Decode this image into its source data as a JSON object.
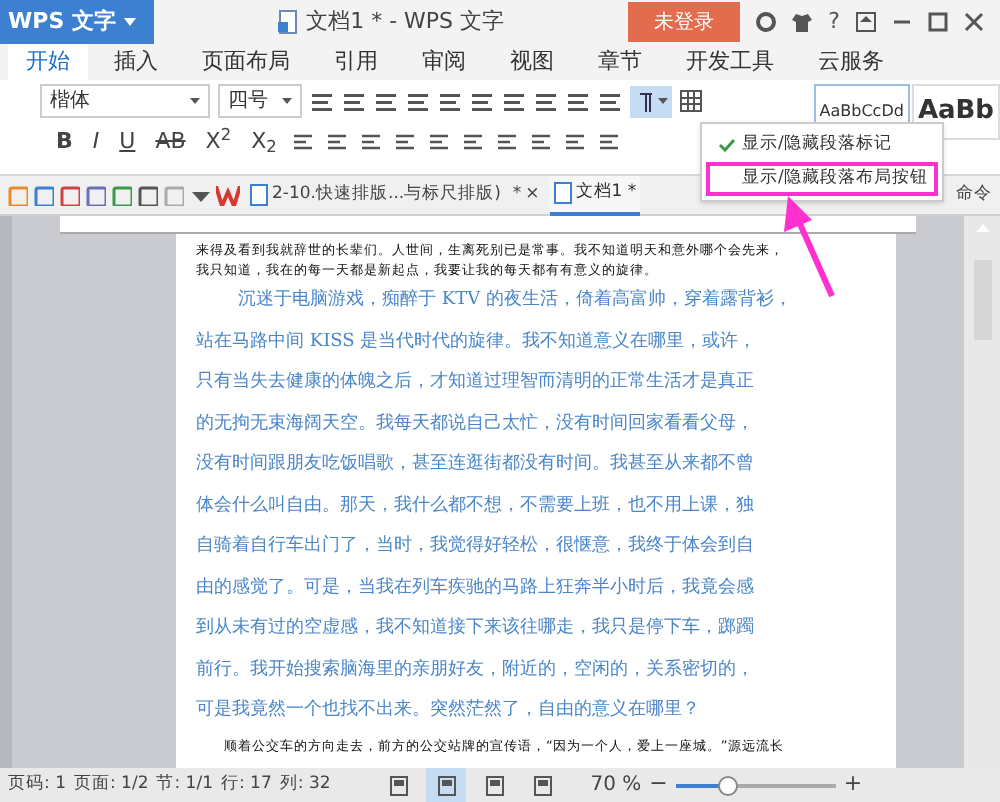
{
  "app_button": {
    "label": "WPS 文字"
  },
  "window": {
    "title": "文档1 * - WPS 文字"
  },
  "login_button": {
    "label": "未登录"
  },
  "help_button": {
    "label": "?"
  },
  "ribbon_tabs": [
    {
      "label": "开始",
      "selected": true
    },
    {
      "label": "插入",
      "selected": false
    },
    {
      "label": "页面布局",
      "selected": false
    },
    {
      "label": "引用",
      "selected": false
    },
    {
      "label": "审阅",
      "selected": false
    },
    {
      "label": "视图",
      "selected": false
    },
    {
      "label": "章节",
      "selected": false
    },
    {
      "label": "开发工具",
      "selected": false
    },
    {
      "label": "云服务",
      "selected": false
    }
  ],
  "font_name": {
    "value": "楷体"
  },
  "font_size": {
    "value": "四号"
  },
  "format_buttons": [
    {
      "label": "B",
      "kind": "bold"
    },
    {
      "label": "I",
      "kind": "italic"
    },
    {
      "label": "U",
      "kind": "underline"
    },
    {
      "label": "AB",
      "kind": "strike"
    },
    {
      "label": "X$^{2}$",
      "kind": "plain"
    },
    {
      "label": "X$_{2}$",
      "kind": "plain"
    }
  ],
  "styles": [
    "AaBbCcDd",
    "AaBb"
  ],
  "menu": {
    "items": [
      {
        "label": "显示/隐藏段落标记",
        "checked": true,
        "selected": false
      },
      {
        "label": "显示/隐藏段落布局按钮",
        "checked": false,
        "selected": true
      }
    ]
  },
  "doc_tabs": [
    {
      "label": "2-10.快速排版...与标尺排版)",
      "modified": "*",
      "close": "×",
      "selected": false
    },
    {
      "label": "文档1 *",
      "selected": true
    }
  ],
  "tabbar_overflow": "命令",
  "document": {
    "paragraphs": [
      {
        "kind": "plain",
        "lines": [
          "来得及看到我就辞世的长辈们。人世间，生离死别已是常事。我不知道明天和意外哪个会先来，",
          "我只知道，我在的每一天都是新起点，我要让我的每天都有有意义的旋律。"
        ]
      },
      {
        "kind": "blue",
        "lines": [
          "沉迷于电脑游戏，痴醉于 KTV 的夜生活，倚着高富帅，穿着露背衫，",
          "站在马路中间 KISS 是当代时代的旋律。我不知道意义在哪里，或许，",
          "只有当失去健康的体魄之后，才知道过理智而清明的正常生活才是真正",
          "的无拘无束海阔天空。我每天都说自己太忙，没有时间回家看看父母，",
          "没有时间跟朋友吃饭唱歌，甚至连逛街都没有时间。我甚至从来都不曾",
          "体会什么叫自由。那天，我什么都不想，不需要上班，也不用上课，独",
          "自骑着自行车出门了，当时，我觉得好轻松，很惬意，我终于体会到自",
          "由的感觉了。可是，当我在列车疾驰的马路上狂奔半小时后，我竟会感",
          "到从未有过的空虚感，我不知道接下来该往哪走，我只是停下车，踯躅",
          "前行。我开始搜索脑海里的亲朋好友，附近的，空闲的，关系密切的，",
          "可是我竟然一个也找不出来。突然茫然了，自由的意义在哪里？"
        ]
      },
      {
        "kind": "plain",
        "lines": [
          "顺着公交车的方向走去，前方的公交站牌的宣传语，“因为一个人，爱上一座城。”源远流长"
        ]
      }
    ]
  },
  "status_bar": {
    "items": [
      "页码: 1",
      "页面: 1/2",
      "节: 1/1",
      "行: 17",
      "列: 32"
    ],
    "view_modes": [
      {
        "selected": false
      },
      {
        "selected": true
      },
      {
        "selected": false
      },
      {
        "selected": false
      }
    ],
    "zoom": "70 %",
    "zoom_slider": {
      "level": 0.33
    },
    "minus": "−",
    "plus": "+"
  }
}
